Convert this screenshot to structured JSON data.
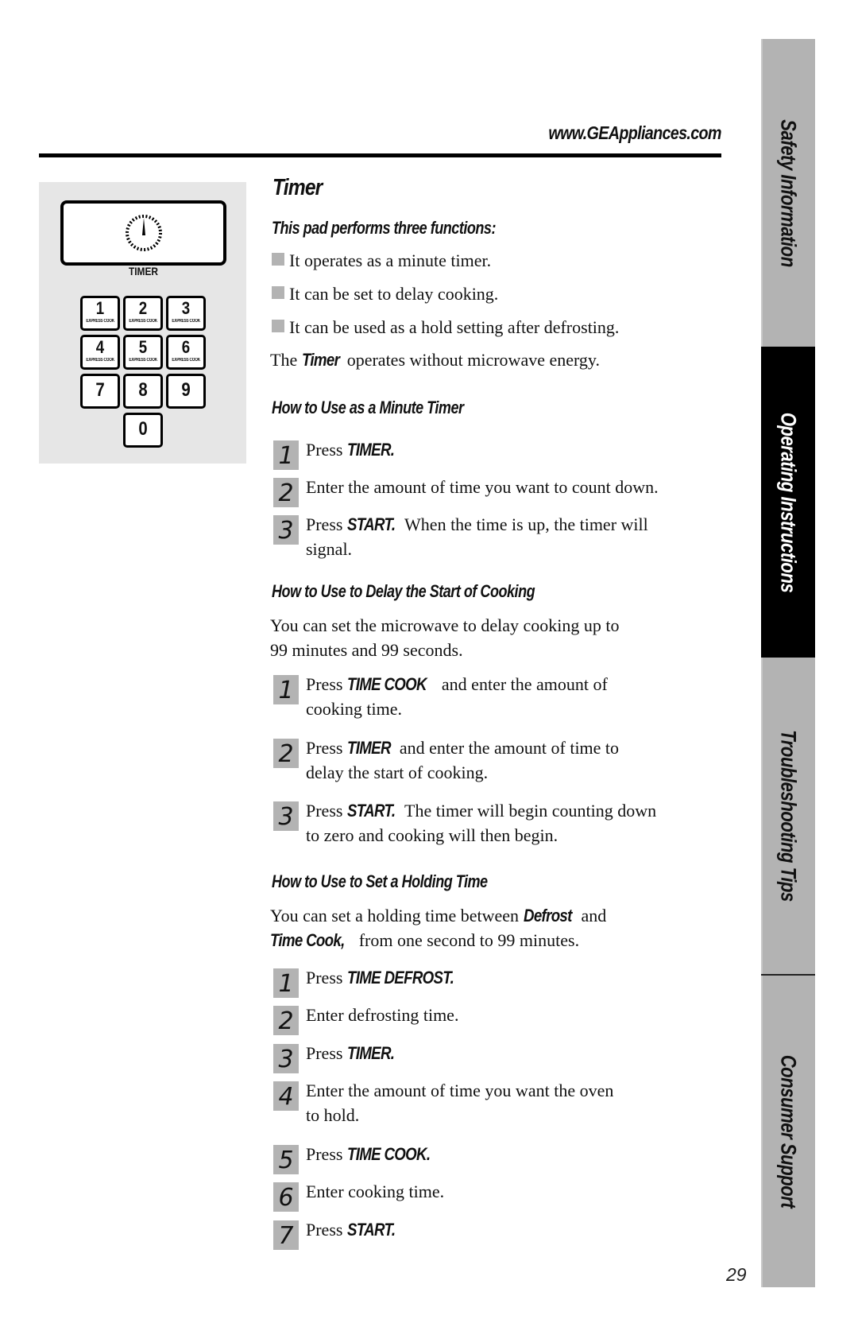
{
  "header": {
    "url": "www.GEAppliances.com"
  },
  "keypad": {
    "timer_label": "TIMER",
    "timer_icon": "clock-dial-icon",
    "keys": [
      {
        "num": "1",
        "sub": "EXPRESS COOK"
      },
      {
        "num": "2",
        "sub": "EXPRESS COOK"
      },
      {
        "num": "3",
        "sub": "EXPRESS COOK"
      },
      {
        "num": "4",
        "sub": "EXPRESS COOK"
      },
      {
        "num": "5",
        "sub": "EXPRESS COOK"
      },
      {
        "num": "6",
        "sub": "EXPRESS COOK"
      },
      {
        "num": "7",
        "sub": ""
      },
      {
        "num": "8",
        "sub": ""
      },
      {
        "num": "9",
        "sub": ""
      },
      {
        "num": "0",
        "sub": ""
      }
    ]
  },
  "main": {
    "title": "Timer",
    "intro_heading": "This pad performs three functions:",
    "bullets": [
      "It operates as a minute timer.",
      "It can be set to delay cooking.",
      "It can be used as a hold setting after defrosting."
    ],
    "note": {
      "pre": "The ",
      "kw": "Timer",
      "post": " operates without microwave energy."
    },
    "minute_timer": {
      "heading": "How to Use as a Minute Timer",
      "steps": [
        {
          "n": "1",
          "pre": "Press ",
          "kw": "TIMER.",
          "post": "",
          "line2": ""
        },
        {
          "n": "2",
          "pre": "Enter the amount of time you want to count down.",
          "kw": "",
          "post": "",
          "line2": ""
        },
        {
          "n": "3",
          "pre": "Press ",
          "kw": "START.",
          "post": " When the time is up, the timer will",
          "line2": "signal."
        }
      ]
    },
    "delay_start": {
      "heading": "How to Use to Delay the Start of Cooking",
      "intro_line1": "You can set the microwave to delay cooking up to",
      "intro_line2": "99 minutes and 99 seconds.",
      "steps": [
        {
          "n": "1",
          "pre": "Press ",
          "kw": "TIME COOK",
          "post": "  and enter the amount of",
          "line2": "cooking time."
        },
        {
          "n": "2",
          "pre": "Press ",
          "kw": "TIMER",
          "post": " and enter the amount of time to",
          "line2": "delay the start of cooking."
        },
        {
          "n": "3",
          "pre": "Press ",
          "kw": "START.",
          "post": " The timer will begin counting down",
          "line2": "to zero and cooking will then begin."
        }
      ]
    },
    "holding_time": {
      "heading": "How to Use to Set a Holding Time",
      "intro_line1_pre": "You can set a holding time between ",
      "intro_line1_kw": "Defrost",
      "intro_line1_post": "  and",
      "intro_line2_kw": "Time Cook,",
      "intro_line2_post": " from one second to 99 minutes.",
      "steps": [
        {
          "n": "1",
          "pre": "Press ",
          "kw": "TIME DEFROST.",
          "post": "",
          "line2": ""
        },
        {
          "n": "2",
          "pre": "Enter defrosting time.",
          "kw": "",
          "post": "",
          "line2": ""
        },
        {
          "n": "3",
          "pre": "Press ",
          "kw": "TIMER.",
          "post": "",
          "line2": ""
        },
        {
          "n": "4",
          "pre": "Enter the amount of time you want the oven",
          "kw": "",
          "post": "",
          "line2": "to hold."
        },
        {
          "n": "5",
          "pre": "Press ",
          "kw": "TIME COOK.",
          "post": "",
          "line2": ""
        },
        {
          "n": "6",
          "pre": "Enter cooking time.",
          "kw": "",
          "post": "",
          "line2": ""
        },
        {
          "n": "7",
          "pre": "Press ",
          "kw": "START.",
          "post": "",
          "line2": ""
        }
      ]
    }
  },
  "sidebar": {
    "tabs": [
      {
        "label": "Safety Information",
        "active": false
      },
      {
        "label": "Operating Instructions",
        "active": true
      },
      {
        "label": "Troubleshooting Tips",
        "active": false
      },
      {
        "label": "Consumer Support",
        "active": false
      }
    ]
  },
  "footer": {
    "page_number": "29"
  }
}
